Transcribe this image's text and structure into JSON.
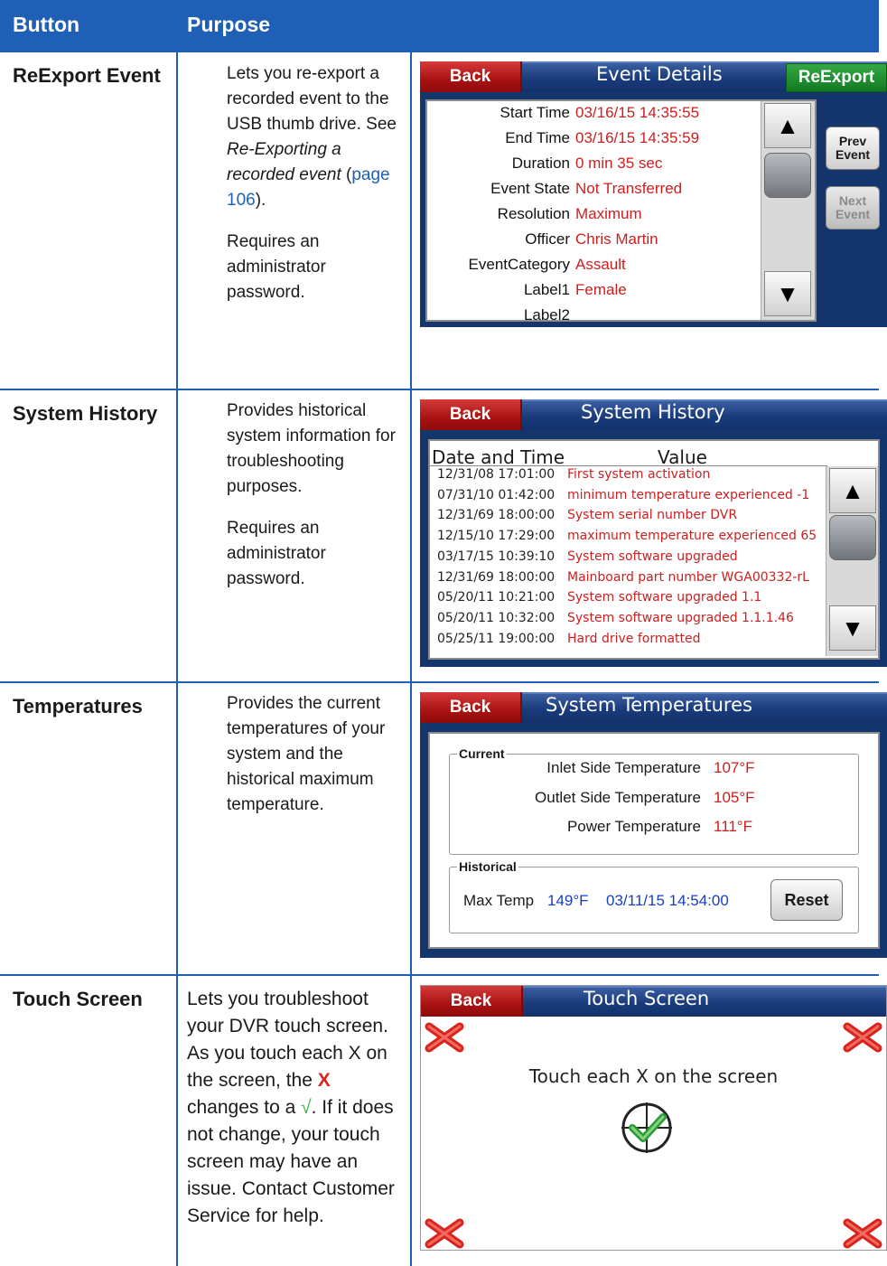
{
  "header": {
    "col_button": "Button",
    "col_purpose": "Purpose"
  },
  "rows": {
    "reexport": {
      "button": "ReExport Event",
      "purpose_p1_a": "Lets you re-export a recorded event to the USB thumb drive. See ",
      "purpose_p1_em": "Re-Exporting a recorded event",
      "purpose_p1_paren_open": " (",
      "purpose_p1_link": "page 106",
      "purpose_p1_close": ").",
      "purpose_p2": "Requires an administrator password."
    },
    "history": {
      "button": "System History",
      "purpose_p1": "Provides historical system information for troubleshooting purposes.",
      "purpose_p2": "Requires an administrator password."
    },
    "temps": {
      "button": "Temperatures",
      "purpose_p1": "Provides the current temperatures of your system and the historical maximum temperature."
    },
    "touch": {
      "button": "Touch Screen",
      "purpose_a": "Lets you troubleshoot your DVR touch screen. As you touch each X on the screen, the ",
      "purpose_x": "X",
      "purpose_b": " changes to a ",
      "purpose_check": "√",
      "purpose_c": ". If it does not change, your touch screen may have an issue. Contact Customer Service for help."
    }
  },
  "event_screen": {
    "back": "Back",
    "title": "Event Details",
    "reexport": "ReExport",
    "prev": "Prev Event",
    "next": "Next Event",
    "fields": [
      {
        "label": "Start Time",
        "value": "03/16/15 14:35:55"
      },
      {
        "label": "End Time",
        "value": "03/16/15 14:35:59"
      },
      {
        "label": "Duration",
        "value": "0 min 35 sec"
      },
      {
        "label": "Event State",
        "value": "Not Transferred"
      },
      {
        "label": "Resolution",
        "value": "Maximum"
      },
      {
        "label": "Officer",
        "value": "Chris Martin"
      },
      {
        "label": "EventCategory",
        "value": "Assault"
      },
      {
        "label": "Label1",
        "value": "Female"
      },
      {
        "label": "Label2",
        "value": ""
      }
    ]
  },
  "history_screen": {
    "back": "Back",
    "title": "System History",
    "col_date": "Date and Time",
    "col_value": "Value",
    "entries": [
      {
        "date": "12/31/08 17:01:00",
        "value": "First system activation"
      },
      {
        "date": "07/31/10 01:42:00",
        "value": "minimum temperature experienced   -1"
      },
      {
        "date": "12/31/69 18:00:00",
        "value": "System serial number  DVR"
      },
      {
        "date": "12/15/10 17:29:00",
        "value": "maximum temperature experienced   65"
      },
      {
        "date": "03/17/15 10:39:10",
        "value": "System software upgraded"
      },
      {
        "date": "12/31/69 18:00:00",
        "value": "Mainboard part number  WGA00332-rL"
      },
      {
        "date": "05/20/11 10:21:00",
        "value": "System software upgraded   1.1"
      },
      {
        "date": "05/20/11 10:32:00",
        "value": "System software upgraded   1.1.1.46"
      },
      {
        "date": "05/25/11 19:00:00",
        "value": "Hard drive formatted"
      }
    ]
  },
  "temp_screen": {
    "back": "Back",
    "title": "System Temperatures",
    "current_caption": "Current",
    "historical_caption": "Historical",
    "current": [
      {
        "label": "Inlet Side Temperature",
        "value": "107°F"
      },
      {
        "label": "Outlet Side Temperature",
        "value": "105°F"
      },
      {
        "label": "Power Temperature",
        "value": "111°F"
      }
    ],
    "max_label": "Max Temp",
    "max_value": "149°F",
    "max_date": "03/11/15 14:54:00",
    "reset": "Reset"
  },
  "touch_screen": {
    "back": "Back",
    "title": "Touch Screen",
    "instruction": "Touch each X on the screen"
  },
  "colors": {
    "table_blue": "#1f5fb5",
    "value_red": "#cc1f1f",
    "history_blue": "#1a3fbf",
    "check_green": "#3cb54a"
  }
}
